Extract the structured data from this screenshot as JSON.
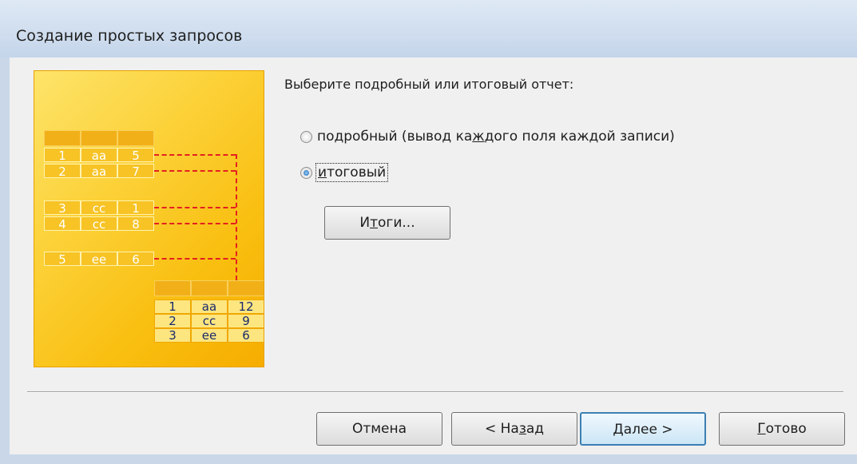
{
  "window": {
    "title": "Создание простых запросов"
  },
  "illustration": {
    "detail_rows": [
      [
        "1",
        "aa",
        "5"
      ],
      [
        "2",
        "aa",
        "7"
      ],
      [
        "3",
        "cc",
        "1"
      ],
      [
        "4",
        "cc",
        "8"
      ],
      [
        "5",
        "ee",
        "6"
      ]
    ],
    "summary_rows": [
      [
        "1",
        "aa",
        "12"
      ],
      [
        "2",
        "cc",
        "9"
      ],
      [
        "3",
        "ee",
        "6"
      ]
    ]
  },
  "prompt": "Выберите подробный или итоговый отчет:",
  "options": [
    {
      "pre": "подробный (вывод ка",
      "mnemonic": "ж",
      "post": "дого поля каждой записи)",
      "checked": false
    },
    {
      "pre": "",
      "mnemonic": "и",
      "post": "тоговый",
      "checked": true
    }
  ],
  "summary_button": {
    "pre": "И",
    "mnemonic": "т",
    "post": "оги..."
  },
  "buttons": {
    "cancel": "Отмена",
    "back": {
      "pre": "< На",
      "mnemonic": "з",
      "post": "ад"
    },
    "next": {
      "pre": "",
      "mnemonic": "Д",
      "post": "алее >"
    },
    "finish": {
      "pre": "",
      "mnemonic": "Г",
      "post": "отово"
    }
  }
}
